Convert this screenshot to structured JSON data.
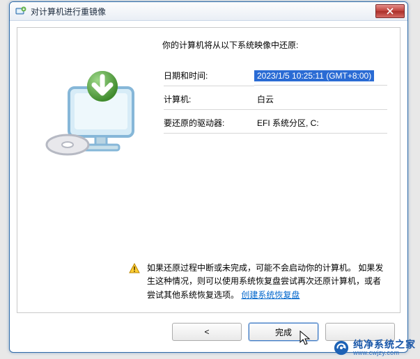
{
  "window": {
    "title": "对计算机进行重镜像"
  },
  "main": {
    "heading": "你的计算机将从以下系统映像中还原:",
    "labels": {
      "datetime": "日期和时间:",
      "computer": "计算机:",
      "drives": "要还原的驱动器:"
    },
    "values": {
      "datetime": "2023/1/5 10:25:11 (GMT+8:00)",
      "computer": "白云",
      "drives": "EFI 系统分区, C:"
    }
  },
  "warning": {
    "line1": "如果还原过程中断或未完成，可能不会启动你的计算机。",
    "line2_before": "如果发生这种情况，则可以使用系统恢复盘尝试再次还原计算机，或者尝试其他系统恢复选项。",
    "link": "创建系统恢复盘"
  },
  "buttons": {
    "back_aria": "上一步",
    "finish": "完成",
    "cancel_aria": "取消"
  },
  "watermark": {
    "name": "纯净系统之家",
    "url": "www.cwjzy.com"
  }
}
